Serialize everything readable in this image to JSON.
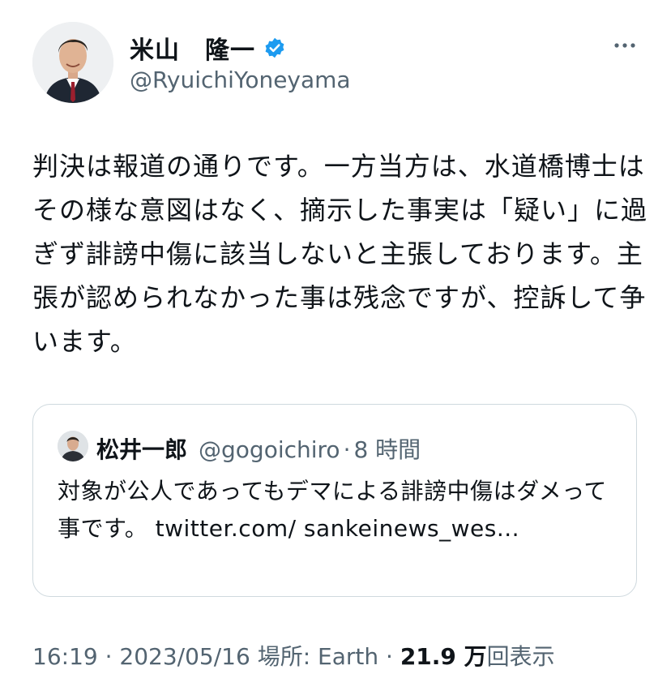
{
  "author": {
    "display_name": "米山　隆一",
    "handle": "@RyuichiYoneyama",
    "verified": true,
    "verified_color": "#1d9bf0"
  },
  "tweet": {
    "text": "判決は報道の通りです。一方当方は、水道橋博士はその様な意図はなく、摘示した事実は「疑い」に過ぎず誹謗中傷に該当しないと主張しております。主張が認められなかった事は残念ですが、控訴して争います。"
  },
  "quote": {
    "display_name": "松井一郎",
    "handle": "@gogoichiro",
    "separator": "·",
    "time": "8 時間",
    "text": "対象が公人であってもデマによる誹謗中傷はダメって事です。",
    "link_text": "twitter.com/ sankeinews_wes..."
  },
  "meta": {
    "time": "16:19",
    "sep1": " · ",
    "date": "2023/05/16",
    "location": " 場所: Earth",
    "sep2": " · ",
    "views_count": "21.9 万",
    "views_label": "回表示"
  },
  "icons": {
    "more": "more-horizontal-icon",
    "verified": "verified-badge-icon"
  }
}
